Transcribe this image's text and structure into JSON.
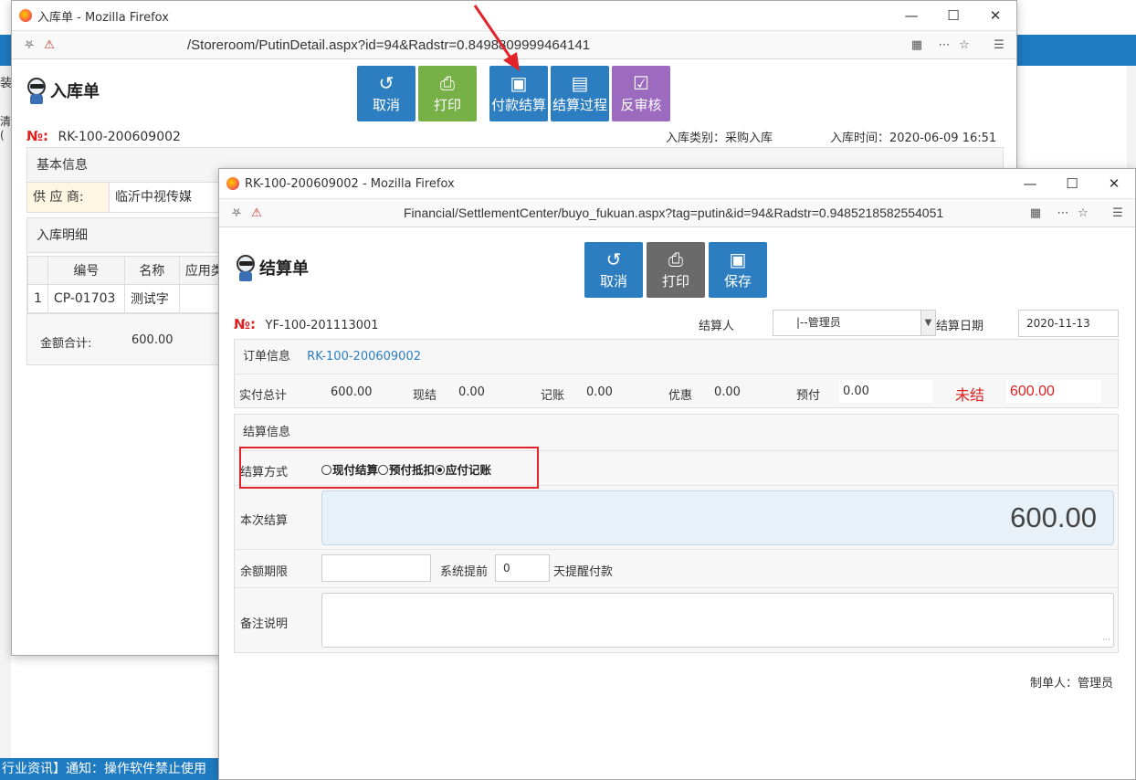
{
  "background": {
    "left_char_1": "装",
    "left_char_2": "清(",
    "ticker": "行业资讯】通知：操作软件禁止使用"
  },
  "back_window": {
    "title": "入库单 - Mozilla Firefox",
    "url_dim": "",
    "url": "/Storeroom/PutinDetail.aspx?id=94&Radstr=0.8498809999464141",
    "page_title": "入库单",
    "toolbar": [
      {
        "label": "取消",
        "icon": "undo-icon",
        "color": "#2d7ec0"
      },
      {
        "label": "打印",
        "icon": "print-icon",
        "color": "#76b047"
      },
      {
        "label": "付款结算",
        "icon": "money-icon",
        "color": "#2d7ec0"
      },
      {
        "label": "结算过程",
        "icon": "document-icon",
        "color": "#2d7ec0"
      },
      {
        "label": "反审核",
        "icon": "check-icon",
        "color": "#9c6bc0"
      }
    ],
    "no_label": "№:",
    "no_value": "RK-100-200609002",
    "type_label": "入库类别：",
    "type_value": "采购入库",
    "time_label": "入库时间：",
    "time_value": "2020-06-09 16:51",
    "basic_info_title": "基本信息",
    "supplier_label": "供 应 商:",
    "supplier_value": "临沂中视传媒",
    "detail_title": "入库明细",
    "detail_headers": [
      "",
      "编号",
      "名称",
      "应用类"
    ],
    "detail_rows": [
      [
        "1",
        "CP-01703",
        "测试字",
        ""
      ]
    ],
    "total_label": "金额合计:",
    "total_value": "600.00"
  },
  "front_window": {
    "title": "RK-100-200609002 - Mozilla Firefox",
    "url": "Financial/SettlementCenter/buyo_fukuan.aspx?tag=putin&id=94&Radstr=0.9485218582554051",
    "page_title": "结算单",
    "toolbar": [
      {
        "label": "取消",
        "icon": "undo-icon",
        "color": "#2d7ec0"
      },
      {
        "label": "打印",
        "icon": "print-icon",
        "color": "#6a6a6a"
      },
      {
        "label": "保存",
        "icon": "save-icon",
        "color": "#2d7ec0"
      }
    ],
    "no_label": "№:",
    "no_value": "YF-100-201113001",
    "settler_label": "结算人",
    "settler_value": "|--管理员",
    "date_label": "结算日期",
    "date_value": "2020-11-13",
    "order_info_label": "订单信息",
    "order_link": "RK-100-200609002",
    "summary": {
      "total_label": "实付总计",
      "total_value": "600.00",
      "cash_label": "现结",
      "cash_value": "0.00",
      "account_label": "记账",
      "account_value": "0.00",
      "discount_label": "优惠",
      "discount_value": "0.00",
      "prepaid_label": "预付",
      "prepaid_value": "0.00",
      "unpaid_label": "未结",
      "unpaid_value": "600.00"
    },
    "settle_info_title": "结算信息",
    "method_label": "结算方式",
    "methods": [
      {
        "label": "现付结算",
        "checked": false
      },
      {
        "label": "预付抵扣",
        "checked": false
      },
      {
        "label": "应付记账",
        "checked": true
      }
    ],
    "this_settle_label": "本次结算",
    "this_settle_value": "600.00",
    "due_label": "余额期限",
    "due_value": "",
    "remind_label": "系统提前",
    "remind_value": "0",
    "remind_suffix": "天提醒付款",
    "note_label": "备注说明",
    "note_value": "",
    "maker_label": "制单人：",
    "maker_value": "管理员"
  },
  "colors": {
    "accent_blue": "#2d7ec0",
    "annotation_red": "#e0242a"
  }
}
